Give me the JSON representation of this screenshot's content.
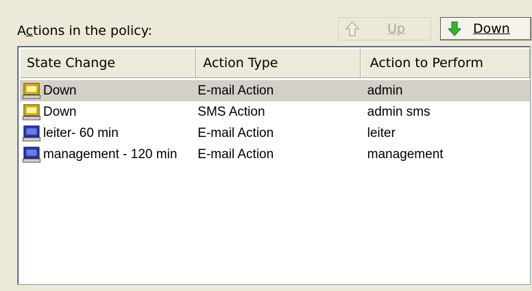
{
  "section": {
    "label_pre": "A",
    "label_accel": "c",
    "label_post": "tions in the policy:"
  },
  "buttons": {
    "up": {
      "label": "Up",
      "enabled": false,
      "icon": "arrow-up-icon"
    },
    "down": {
      "label": "Down",
      "enabled": true,
      "icon": "arrow-down-icon"
    }
  },
  "table": {
    "columns": [
      "State Change",
      "Action Type",
      "Action to Perform"
    ],
    "rows": [
      {
        "state": "Down",
        "type": "E-mail Action",
        "action": "admin",
        "icon": "yellow-computer-icon",
        "selected": true
      },
      {
        "state": "Down",
        "type": "SMS Action",
        "action": "admin sms",
        "icon": "yellow-computer-icon",
        "selected": false
      },
      {
        "state": "leiter- 60 min",
        "type": "E-mail Action",
        "action": "leiter",
        "icon": "blue-computer-icon",
        "selected": false
      },
      {
        "state": "management - 120 min",
        "type": "E-mail Action",
        "action": "management",
        "icon": "blue-computer-icon",
        "selected": false
      }
    ]
  },
  "colors": {
    "yellow_icon": "#e8c300",
    "blue_icon": "#2a3cb8",
    "arrow_green": "#2db82d"
  }
}
